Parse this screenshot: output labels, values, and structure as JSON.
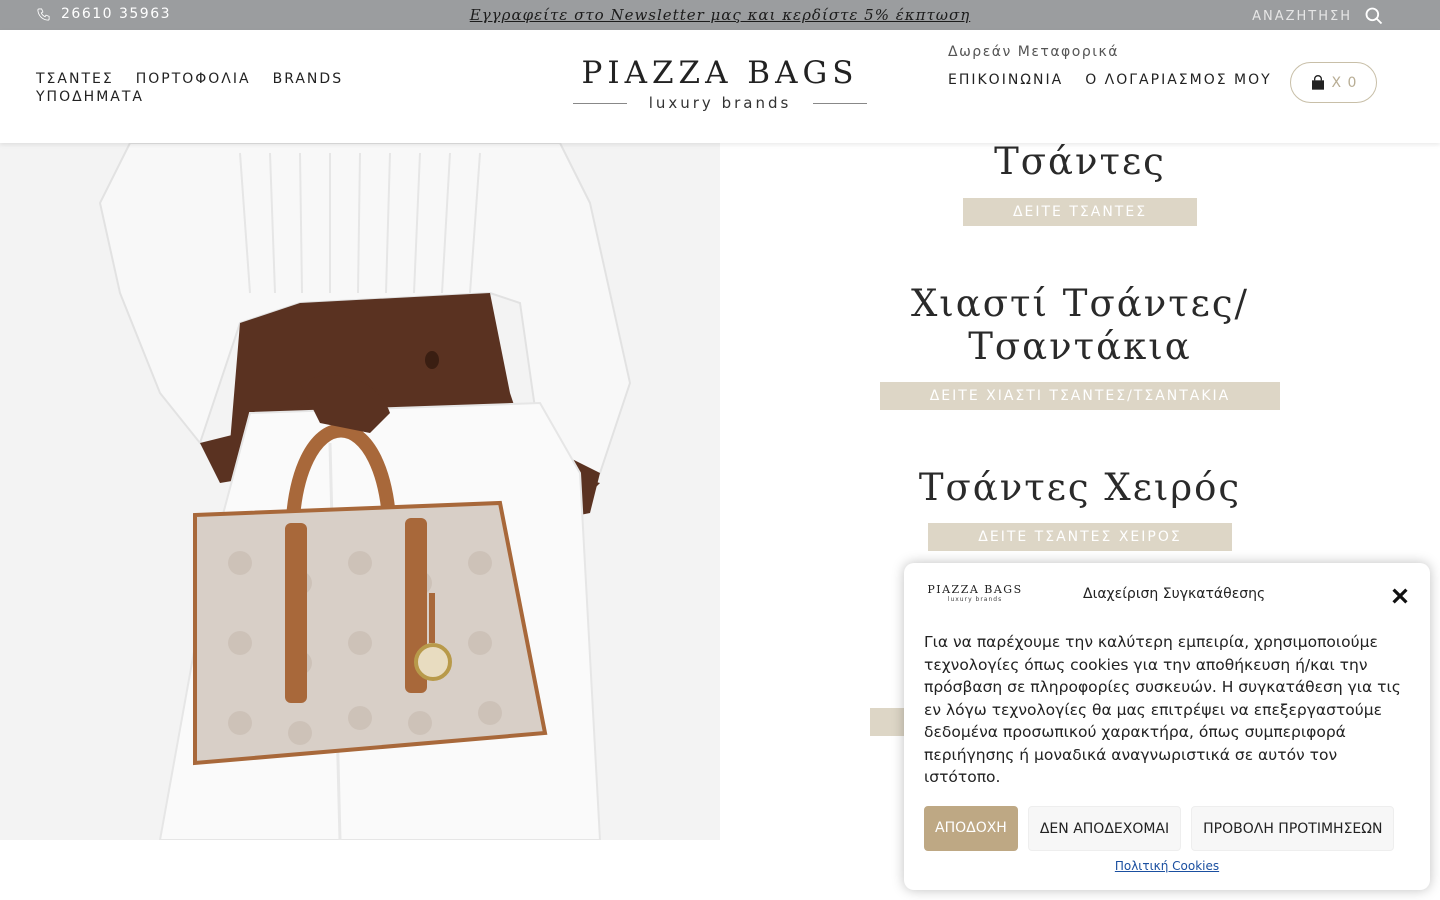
{
  "topbar": {
    "phone": "26610 35963",
    "newsletter": "Εγγραφείτε στο Newsletter μας και κερδίστε 5% έκπτωση",
    "search_label": "ΑΝΑΖΗΤΗΣΗ"
  },
  "header": {
    "nav_left": [
      "ΤΣΑΝΤΕΣ",
      "ΠΟΡΤΟΦΟΛΙΑ",
      "BRANDS",
      "ΥΠΟΔΗΜΑΤΑ"
    ],
    "logo_brand": "PIAZZA BAGS",
    "logo_sub": "luxury brands",
    "free_shipping": "Δωρεάν Μεταφορικά",
    "nav_right": [
      "ΕΠΙΚΟΙΝΩΝΙΑ",
      "Ο ΛΟΓΑΡΙΑΣΜΟΣ ΜΟΥ"
    ],
    "cart_label": "X 0"
  },
  "categories": [
    {
      "title": "Τσάντες",
      "button": "ΔΕΙΤΕ ΤΣΑΝΤΕΣ"
    },
    {
      "title": "Χιαστί Τσάντες/ Τσαντάκια",
      "button": "ΔΕΙΤΕ ΧΙΑΣΤΙ ΤΣΑΝΤΕΣ/ΤΣΑΝΤΑΚΙΑ"
    },
    {
      "title": "Τσάντες Χειρός",
      "button": "ΔΕΙΤΕ ΤΣΑΝΤΕΣ ΧΕΙΡΟΣ"
    }
  ],
  "cookie": {
    "logo_brand": "PIAZZA BAGS",
    "logo_sub": "luxury brands",
    "title": "Διαχείριση Συγκατάθεσης",
    "text": "Για να παρέχουμε την καλύτερη εμπειρία, χρησιμοποιούμε τεχνολογίες όπως cookies για την αποθήκευση ή/και την πρόσβαση σε πληροφορίες συσκευών. Η συγκατάθεση για τις εν λόγω τεχνολογίες θα μας επιτρέψει να επεξεργαστούμε δεδομένα προσωπικού χαρακτήρα, όπως συμπεριφορά περιήγησης ή μοναδικά αναγνωριστικά σε αυτόν τον ιστότοπο.",
    "accept": "ΑΠΟΔΟΧΗ",
    "deny": "ΔΕΝ ΑΠΟΔΕΧΟΜΑΙ",
    "preferences": "ΠΡΟΒΟΛΗ ΠΡΟΤΙΜΗΣΕΩΝ",
    "policy": "Πολιτική Cookies"
  },
  "colors": {
    "topbar_bg": "#9b9d9f",
    "button_beige": "#ddd6c6",
    "accept_bg": "#bea884",
    "cart_border": "#c8bfa8"
  }
}
